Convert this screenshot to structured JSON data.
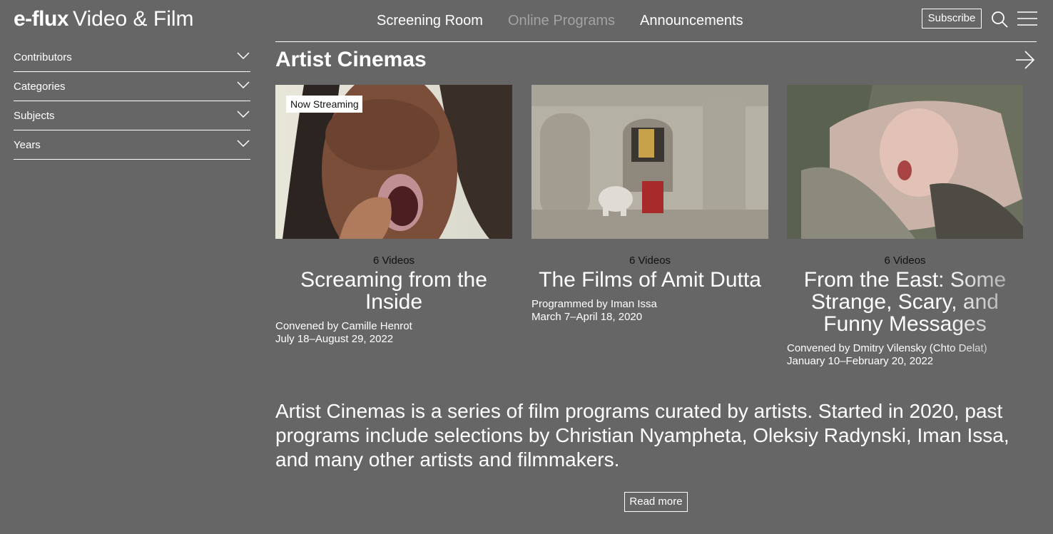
{
  "header": {
    "brand_bold": "e-flux",
    "brand_light": "Video & Film",
    "nav": [
      {
        "label": "Screening Room"
      },
      {
        "label": "Online Programs"
      },
      {
        "label": "Announcements"
      }
    ],
    "subscribe_label": "Subscribe",
    "icons": {
      "search": "search-icon",
      "menu": "hamburger-menu-icon"
    }
  },
  "sidebar": {
    "filters": [
      {
        "label": "Contributors"
      },
      {
        "label": "Categories"
      },
      {
        "label": "Subjects"
      },
      {
        "label": "Years"
      }
    ],
    "icon": "chevron-down-icon"
  },
  "section": {
    "title": "Artist Cinemas",
    "arrow_icon": "arrow-right-icon",
    "cards": [
      {
        "badge": "Now Streaming",
        "count": "6 Videos",
        "title": "Screaming from the Inside",
        "byline": "Convened by Camille Henrot",
        "dates": "July 18–August 29, 2022"
      },
      {
        "count": "6 Videos",
        "title": "The Films of Amit Dutta",
        "byline": "Programmed by Iman Issa",
        "dates": "March 7–April 18, 2020"
      },
      {
        "count": "6 Videos",
        "title": "From the East: Some Strange, Scary, and Funny Messages",
        "byline": "Convened by Dmitry Vilensky (Chto Delat)",
        "dates": "January 10–February 20, 2022"
      }
    ],
    "description": "Artist Cinemas is a series of film programs curated by artists. Started in 2020, past programs include selections by Christian Nyampheta, Oleksiy Radynski, Iman Issa, and many other artists and filmmakers.",
    "read_more_label": "Read more"
  },
  "colors": {
    "background": "#666666",
    "text": "#ffffff",
    "count_text": "#111111",
    "inactive_nav": "#a3a3a3"
  }
}
